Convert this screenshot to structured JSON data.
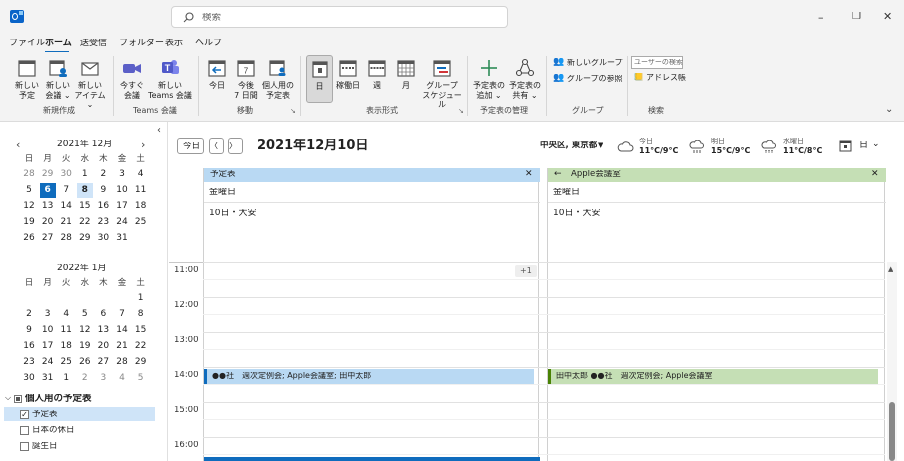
{
  "titlebar": {
    "search_placeholder": "検索",
    "min": "–",
    "restore": "❐",
    "close": "✕"
  },
  "menu": {
    "file": "ファイル",
    "home": "ホーム",
    "sendrecv": "送受信",
    "folder": "フォルダー",
    "view": "表示",
    "help": "ヘルプ"
  },
  "ribbon": {
    "new_appt_1": "新しい",
    "new_appt_2": "予定",
    "new_meeting_1": "新しい",
    "new_meeting_2": "会議 ⌄",
    "new_items_1": "新しい",
    "new_items_2": "アイテム ⌄",
    "group_new": "新規作成",
    "meet_now_1": "今すぐ",
    "meet_now_2": "会議",
    "teams_1": "新しい",
    "teams_2": "Teams 会議",
    "group_teams": "Teams 会議",
    "today": "今日",
    "next7_1": "今後",
    "next7_2": "7 日間",
    "personal_1": "個人用の",
    "personal_2": "予定表",
    "group_goto": "移動",
    "day": "日",
    "workweek": "稼働日",
    "week": "週",
    "month": "月",
    "sched_1": "グループ",
    "sched_2": "スケジュール",
    "group_arrange": "表示形式",
    "add_1": "予定表の",
    "add_2": "追加 ⌄",
    "share_1": "予定表の",
    "share_2": "共有 ⌄",
    "group_manage": "予定表の管理",
    "new_group": "新しいグループ",
    "browse_groups": "グループの参照",
    "group_groups": "グループ",
    "search_people_placeholder": "ユーザーの検索",
    "address_book": "アドレス帳",
    "group_find": "検索",
    "collapse": "⌄"
  },
  "nav": {
    "today_btn": "今日",
    "prev": "〈",
    "next": "〉",
    "date_title": "2021年12月10日"
  },
  "weather": {
    "location": "中央区, 東京都",
    "t1_label": "今日",
    "t1_temp": "11°C/9°C",
    "t2_label": "明日",
    "t2_temp": "15°C/9°C",
    "t3_label": "水曜日",
    "t3_temp": "11°C/8°C",
    "view_mode": "日"
  },
  "mini1": {
    "title": "2021年 12月",
    "prev": "‹",
    "next": "›",
    "weekdays": [
      "日",
      "月",
      "火",
      "水",
      "木",
      "金",
      "土"
    ],
    "days": [
      "28",
      "29",
      "30",
      "1",
      "2",
      "3",
      "4",
      "5",
      "6",
      "7",
      "8",
      "9",
      "10",
      "11",
      "12",
      "13",
      "14",
      "15",
      "16",
      "17",
      "18",
      "19",
      "20",
      "21",
      "22",
      "23",
      "24",
      "25",
      "26",
      "27",
      "28",
      "29",
      "30",
      "31"
    ],
    "other": [
      0,
      1,
      2
    ],
    "today": 8,
    "selected": 10
  },
  "mini2": {
    "title": "2022年 1月",
    "weekdays": [
      "日",
      "月",
      "火",
      "水",
      "木",
      "金",
      "土"
    ],
    "days": [
      "",
      "",
      "",
      "",
      "",
      "",
      "1",
      "2",
      "3",
      "4",
      "5",
      "6",
      "7",
      "8",
      "9",
      "10",
      "11",
      "12",
      "13",
      "14",
      "15",
      "16",
      "17",
      "18",
      "19",
      "20",
      "21",
      "22",
      "23",
      "24",
      "25",
      "26",
      "27",
      "28",
      "29",
      "30",
      "31",
      "1",
      "2",
      "3",
      "4",
      "5"
    ],
    "other": [
      38,
      39,
      40,
      41,
      42
    ]
  },
  "sidebar_collapse": "‹",
  "calendars": {
    "header": "個人用の予定表",
    "items": [
      {
        "label": "予定表",
        "checked": true
      },
      {
        "label": "日本の休日",
        "checked": false
      },
      {
        "label": "誕生日",
        "checked": false
      }
    ]
  },
  "pane1": {
    "title": "予定表",
    "close": "✕",
    "weekday": "金曜日",
    "rokuyo": "10日・大安",
    "overflow": "+1",
    "event": "●●社　週次定例会; Apple会議室; 田中太郎",
    "color": "#0f6cbd",
    "bg": "#b9d9f3"
  },
  "pane2": {
    "back": "←",
    "title": "Apple会議室",
    "close": "✕",
    "weekday": "金曜日",
    "rokuyo": "10日・大安",
    "event": "田中太郎 ●●社　週次定例会; Apple会議室",
    "color": "#498205",
    "bg": "#c5dfb5"
  },
  "hours": [
    "11:00",
    "12:00",
    "13:00",
    "14:00",
    "15:00",
    "16:00"
  ]
}
